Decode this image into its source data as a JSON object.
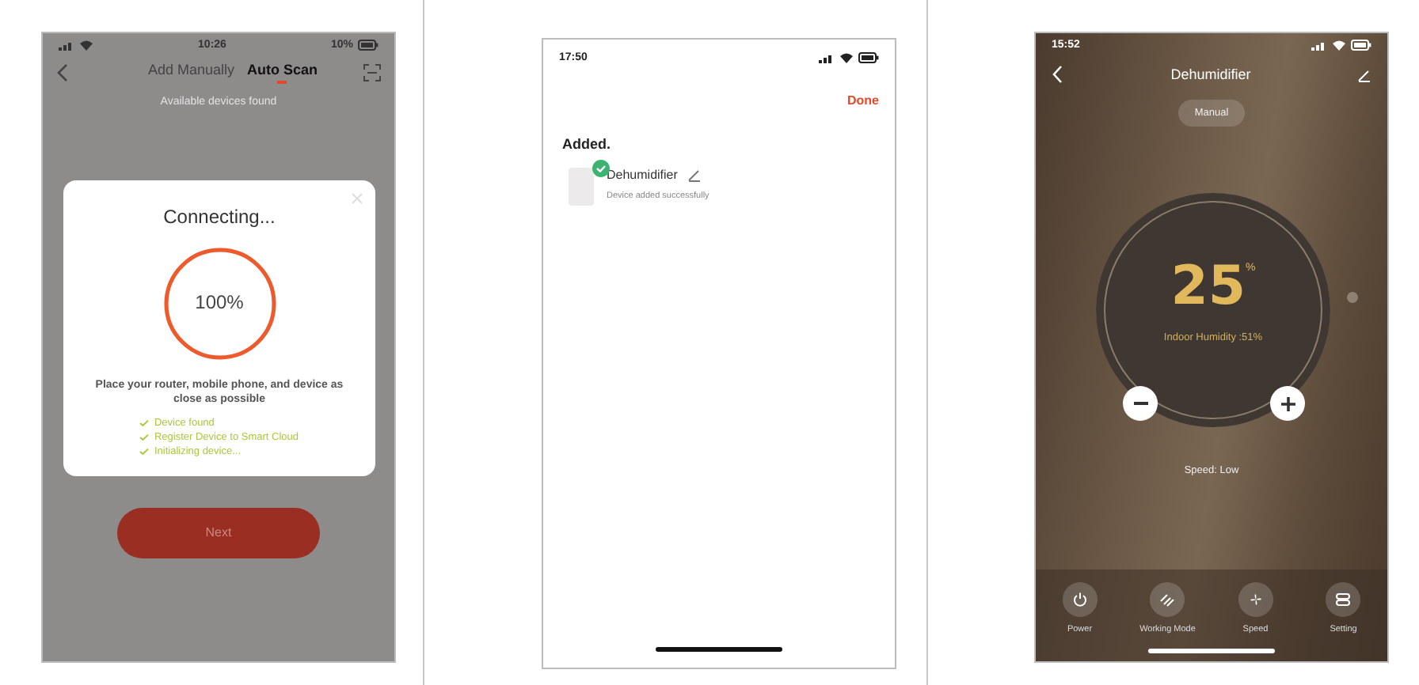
{
  "scan_screen": {
    "status_bar": {
      "time": "10:26",
      "battery": "10%"
    },
    "tabs": [
      {
        "label": "Add Manually",
        "selected": false
      },
      {
        "label": "Auto Scan",
        "selected": true
      }
    ],
    "subtitle": "Available devices found",
    "dialog": {
      "title": "Connecting...",
      "progress": {
        "reading": "100%",
        "level": 1
      },
      "hint": "Place your router, mobile phone, and device as close as possible",
      "steps": [
        {
          "label": "Device found",
          "done": true
        },
        {
          "label": "Register Device to Smart Cloud",
          "done": true
        },
        {
          "label": "Initializing device...",
          "done": true
        }
      ]
    },
    "next_button": "Next"
  },
  "added_screen": {
    "status_bar": {
      "time": "17:50"
    },
    "done_button": "Done",
    "heading": "Added.",
    "device": {
      "name": "Dehumidifier",
      "status": "Device added successfully"
    }
  },
  "control_screen": {
    "status_bar": {
      "time": "15:52"
    },
    "title": "Dehumidifier",
    "mode": "Manual",
    "target": "25",
    "unit": "%",
    "humidity": "Indoor Humidity :51%",
    "speed": "Speed: Low",
    "actions": [
      {
        "label": "Power",
        "kind": "power"
      },
      {
        "label": "Working Mode",
        "kind": "mode"
      },
      {
        "label": "Speed",
        "kind": "fan"
      },
      {
        "label": "Setting",
        "kind": "setting"
      }
    ]
  }
}
